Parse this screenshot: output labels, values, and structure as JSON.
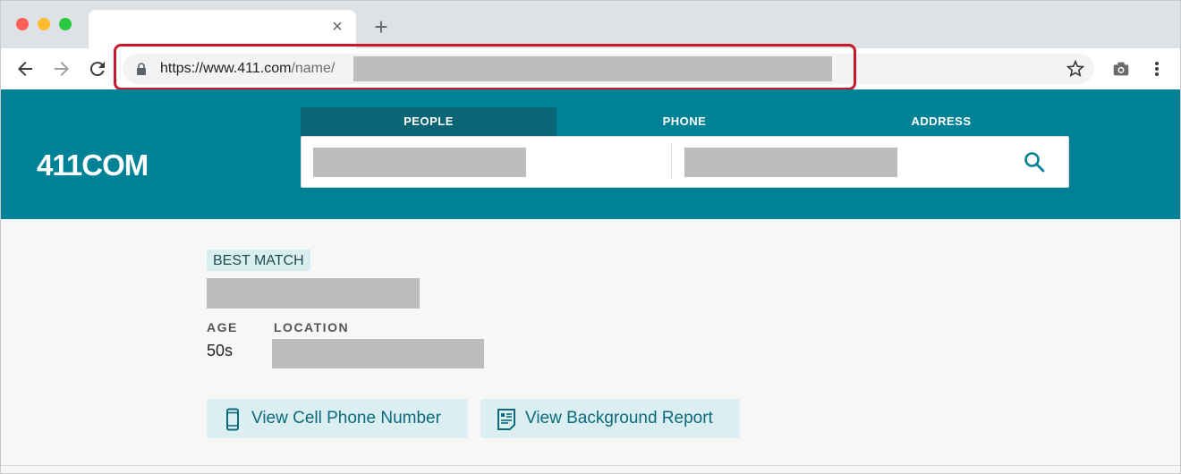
{
  "browser": {
    "tab_close": "×",
    "new_tab": "+",
    "url_host": "https://www.411.com",
    "url_path": "/name/"
  },
  "site": {
    "logo": "411COM",
    "search_tabs": [
      "PEOPLE",
      "PHONE",
      "ADDRESS"
    ],
    "active_tab": "PEOPLE"
  },
  "result": {
    "badge": "BEST MATCH",
    "age_label": "AGE",
    "location_label": "LOCATION",
    "age_value": "50s",
    "buttons": {
      "cell_phone": "View Cell Phone Number",
      "background_report": "View Background Report"
    }
  },
  "colors": {
    "brand_teal": "#008296",
    "active_tab": "#0c6574",
    "highlight_red": "#c61a2b",
    "button_bg": "#dbeef2",
    "button_text": "#0b6b7c"
  },
  "icons": {
    "back": "back-arrow-icon",
    "forward": "forward-arrow-icon",
    "reload": "reload-icon",
    "lock": "lock-icon",
    "star": "star-icon",
    "camera": "camera-icon",
    "menu": "kebab-menu-icon",
    "search": "search-icon",
    "phone": "mobile-phone-icon",
    "report": "report-icon"
  }
}
